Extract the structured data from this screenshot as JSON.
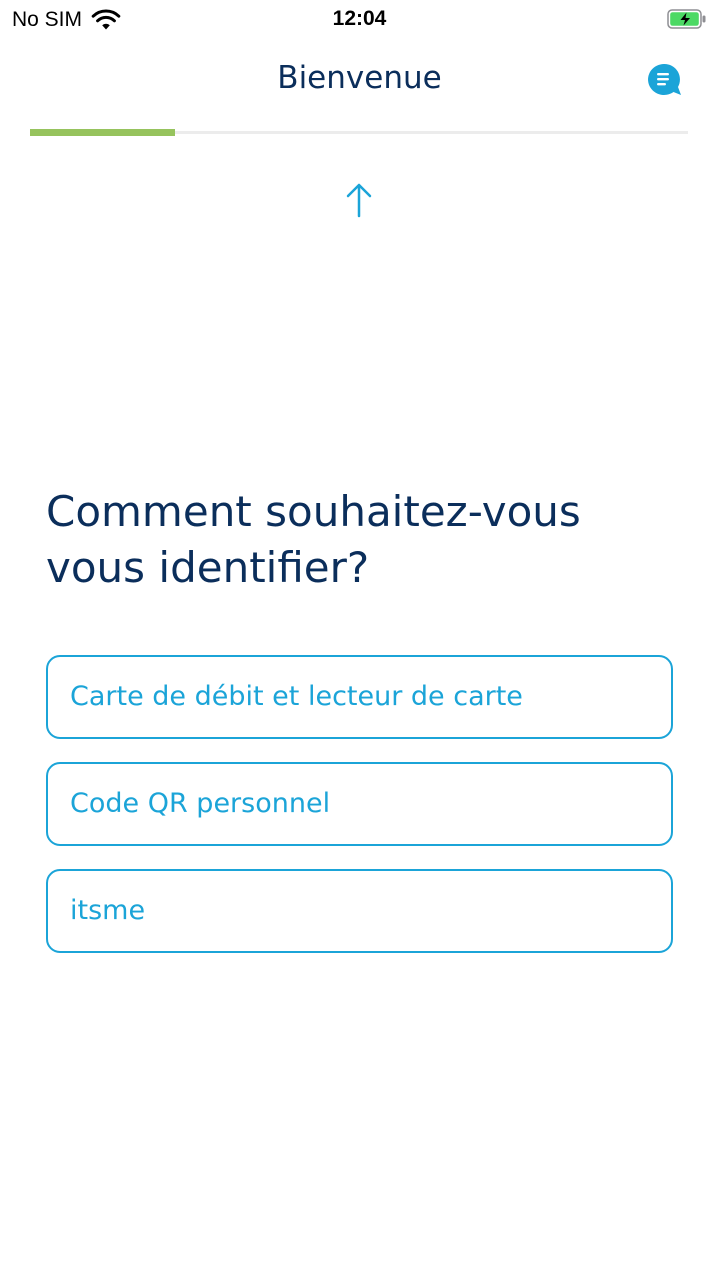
{
  "status_bar": {
    "carrier": "No SIM",
    "time": "12:04",
    "icons": [
      "wifi-icon",
      "battery-charging-icon"
    ],
    "battery_color": "#4cd964"
  },
  "header": {
    "title": "Bienvenue",
    "chat_icon": "chat-bubble-icon"
  },
  "progress": {
    "fraction": 0.22,
    "color": "#96c35d"
  },
  "main": {
    "up_arrow_icon": "arrow-up-icon",
    "question": "Comment souhaitez-vous vous identifier?",
    "options": [
      {
        "label": "Carte de débit et lecteur de carte"
      },
      {
        "label": "Code QR personnel"
      },
      {
        "label": "itsme"
      }
    ]
  },
  "colors": {
    "accent": "#1ba4d8",
    "title": "#0b2e5b",
    "progress": "#96c35d"
  }
}
